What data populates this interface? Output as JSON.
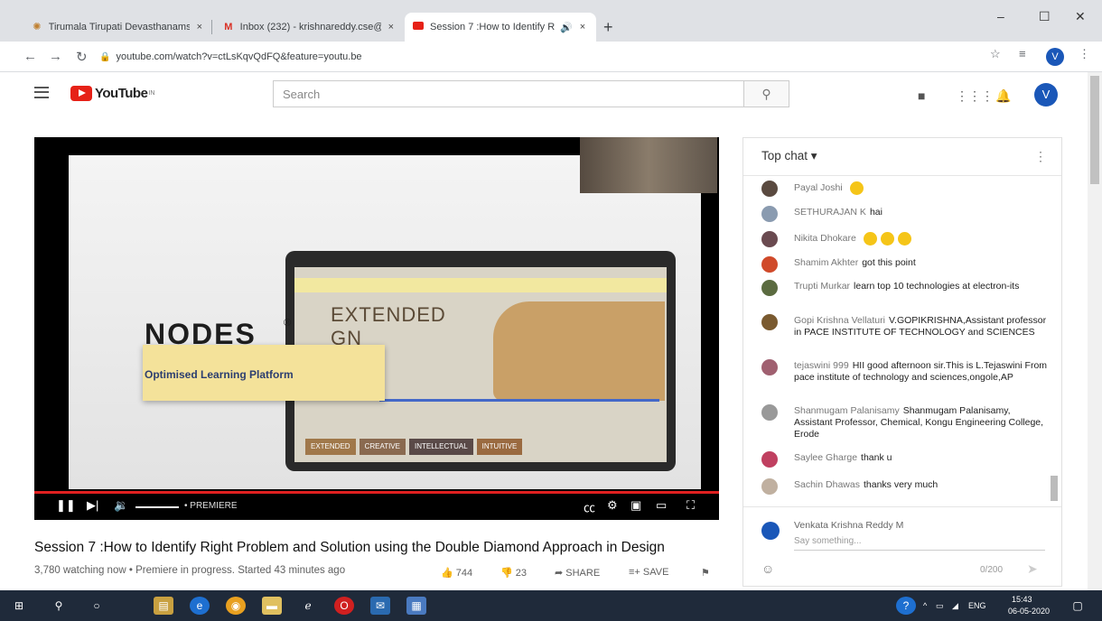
{
  "browser": {
    "tabs": [
      {
        "label": "Tirumala Tirupati Devasthanams",
        "close": "×"
      },
      {
        "label": "Inbox (232) - krishnareddy.cse@",
        "close": "×"
      },
      {
        "label": "Session 7 :How to Identify R",
        "close": "×"
      }
    ],
    "new_tab": "+",
    "url": "youtube.com/watch?v=ctLsKqvQdFQ&feature=youtu.be",
    "profile_initial": "V"
  },
  "youtube": {
    "logo_text": "YouTube",
    "logo_sup": "IN",
    "search_placeholder": "Search",
    "user_initial": "V"
  },
  "video": {
    "slide_brand": "NODES",
    "slide_reg": "®",
    "slide_tagline": "Optimised Learning Platform",
    "slide_heading": "EXTENDED\nGN\nKING",
    "slide_chips": [
      "EXTENDED",
      "CREATIVE",
      "INTELLECTUAL",
      "INTUITIVE"
    ],
    "player_status": "• PREMIERE",
    "title": "Session 7 :How to Identify Right Problem and Solution using the Double Diamond Approach in Design",
    "meta": "3,780 watching now • Premiere in progress. Started 43 minutes ago",
    "likes": "744",
    "dislikes": "23",
    "share_label": "SHARE",
    "save_label": "SAVE"
  },
  "chat": {
    "header": "Top chat ▾",
    "messages": [
      {
        "author": "Payal Joshi",
        "text": "",
        "emoji_count": 1,
        "color": "#5a4a40"
      },
      {
        "author": "SETHURAJAN K",
        "text": "hai",
        "emoji_count": 0,
        "color": "#8a9bb0"
      },
      {
        "author": "Nikita Dhokare",
        "text": "",
        "emoji_count": 3,
        "color": "#6a4a50"
      },
      {
        "author": "Shamim Akhter",
        "text": "got this point",
        "emoji_count": 0,
        "color": "#d04a2a"
      },
      {
        "author": "Trupti Murkar",
        "text": "learn top 10 technologies at electron-its",
        "emoji_count": 0,
        "color": "#5b6b40"
      },
      {
        "author": "Gopi Krishna Vellaturi",
        "text": "V.GOPIKRISHNA,Assistant professor in PACE INSTITUTE OF TECHNOLOGY and SCIENCES",
        "emoji_count": 0,
        "color": "#7a5a30"
      },
      {
        "author": "tejaswini 999",
        "text": "HII good afternoon sir.This is L.Tejaswini From pace institute of technology and sciences,ongole,AP",
        "emoji_count": 0,
        "color": "#a06070"
      },
      {
        "author": "Shanmugam Palanisamy",
        "text": "Shanmugam Palanisamy, Assistant Professor, Chemical, Kongu Engineering College, Erode",
        "emoji_count": 0,
        "color": "#999999"
      },
      {
        "author": "Saylee Gharge",
        "text": "thank u",
        "emoji_count": 0,
        "color": "#c04060"
      },
      {
        "author": "Sachin Dhawas",
        "text": "thanks very much",
        "emoji_count": 0,
        "color": "#c0b0a0"
      }
    ],
    "input_author": "Venkata Krishna Reddy M",
    "input_placeholder": "Say something...",
    "char_count": "0/200"
  },
  "taskbar": {
    "lang": "ENG",
    "time": "15:43",
    "date": "06-05-2020"
  }
}
